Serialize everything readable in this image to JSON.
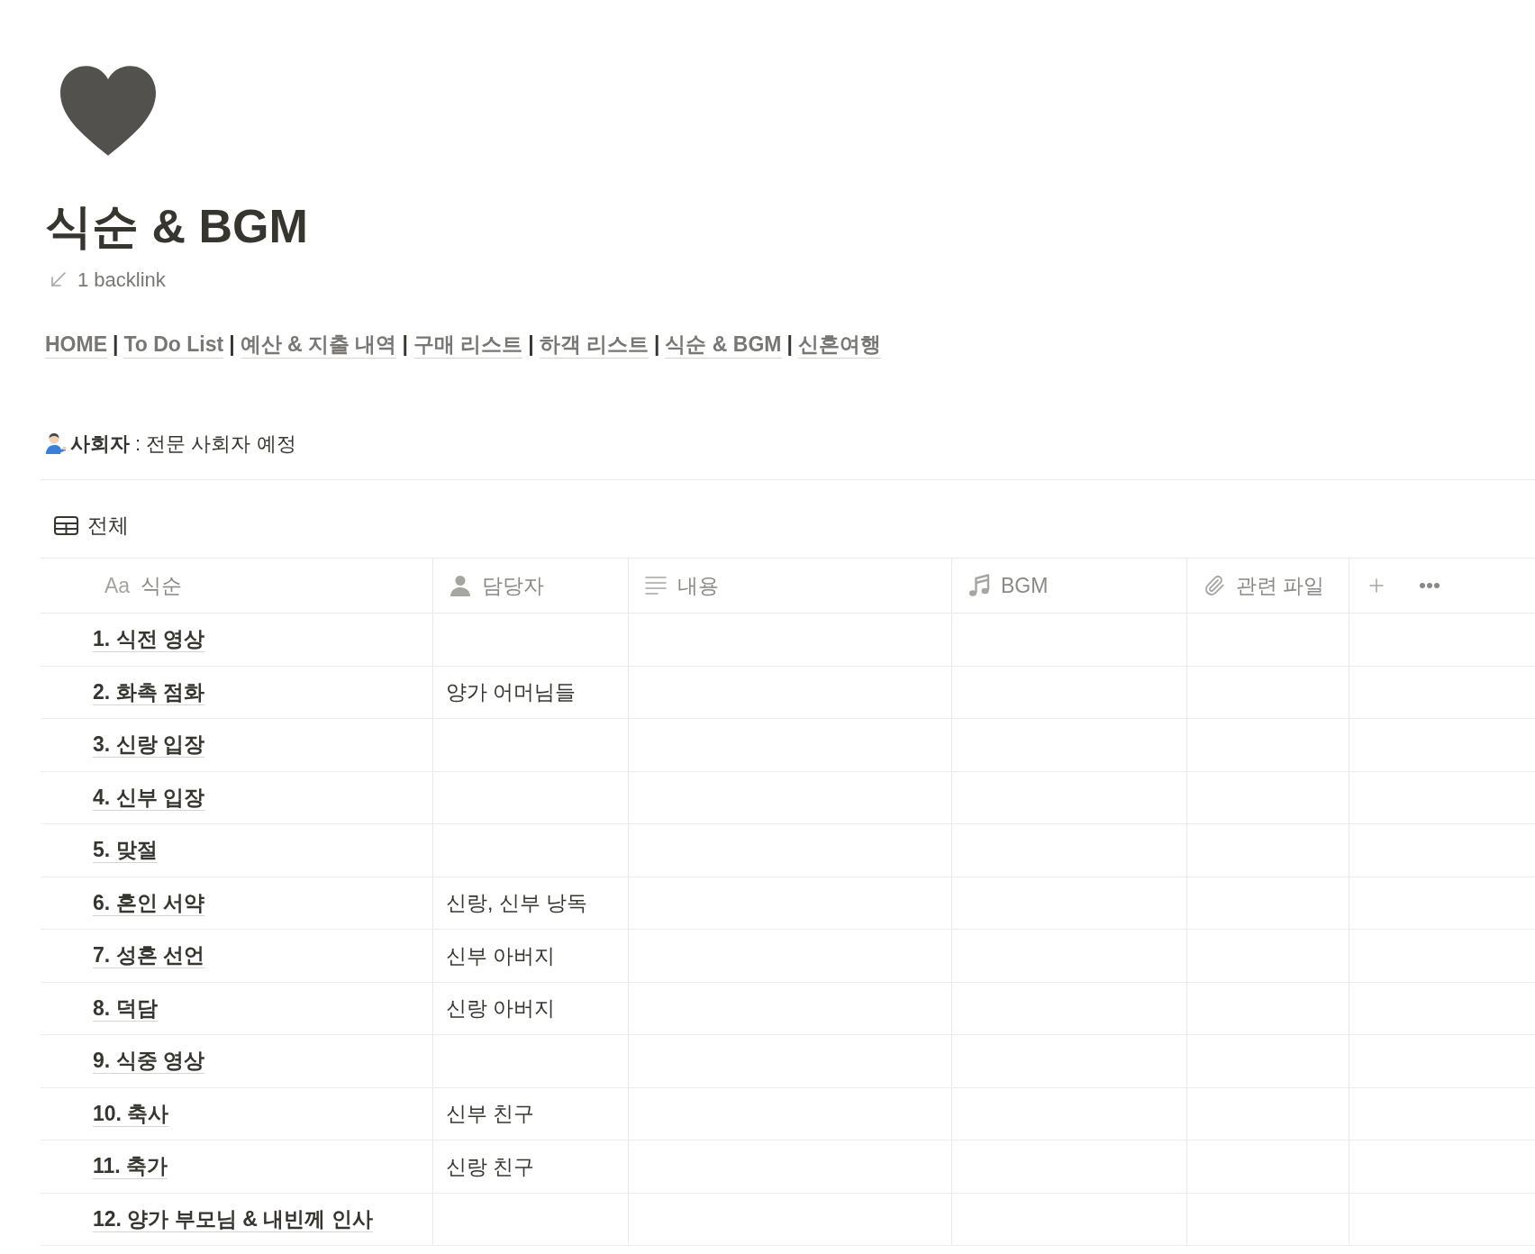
{
  "page": {
    "title": "식순 & BGM",
    "backlink": "1 backlink"
  },
  "nav": [
    {
      "kind": "link",
      "text": "HOME"
    },
    {
      "kind": "separator",
      "text": "|"
    },
    {
      "kind": "link",
      "text": "To Do List"
    },
    {
      "kind": "separator",
      "text": "|"
    },
    {
      "kind": "link",
      "text": "예산 & 지출 내역"
    },
    {
      "kind": "separator",
      "text": "|"
    },
    {
      "kind": "link",
      "text": "구매 리스트"
    },
    {
      "kind": "separator",
      "text": "|"
    },
    {
      "kind": "link",
      "text": "하객 리스트"
    },
    {
      "kind": "separator",
      "text": "|"
    },
    {
      "kind": "link",
      "text": "식순 & BGM"
    },
    {
      "kind": "separator",
      "text": "|"
    },
    {
      "kind": "link",
      "text": "신혼여행"
    }
  ],
  "note": {
    "text": "**사회자** : 전문 사회자 예정"
  },
  "view": {
    "name": "전체"
  },
  "table": {
    "columns": [
      {
        "kind": "title",
        "type_glyph": "Aa",
        "label": "식순"
      },
      {
        "kind": "person",
        "label": "담당자"
      },
      {
        "kind": "text",
        "label": "내용"
      },
      {
        "kind": "music",
        "label": "BGM"
      },
      {
        "kind": "file",
        "label": "관련 파일"
      }
    ],
    "rows": [
      {
        "title": "1. 식전 영상"
      },
      {
        "title": "2. 화촉 점화",
        "assignee": "양가 어머님들"
      },
      {
        "title": "3. 신랑 입장"
      },
      {
        "title": "4. 신부 입장"
      },
      {
        "title": "5. 맞절"
      },
      {
        "title": "6. 혼인 서약",
        "assignee": "신랑, 신부 낭독"
      },
      {
        "title": "7. 성혼 선언",
        "assignee": "신부 아버지"
      },
      {
        "title": "8. 덕담",
        "assignee": "신랑 아버지"
      },
      {
        "title": "9. 식중 영상"
      },
      {
        "title": "10. 축사",
        "assignee": "신부 친구"
      },
      {
        "title": "11. 축가",
        "assignee": "신랑 친구"
      },
      {
        "title": "12. 양가 부모님 & 내빈께 인사"
      }
    ]
  }
}
